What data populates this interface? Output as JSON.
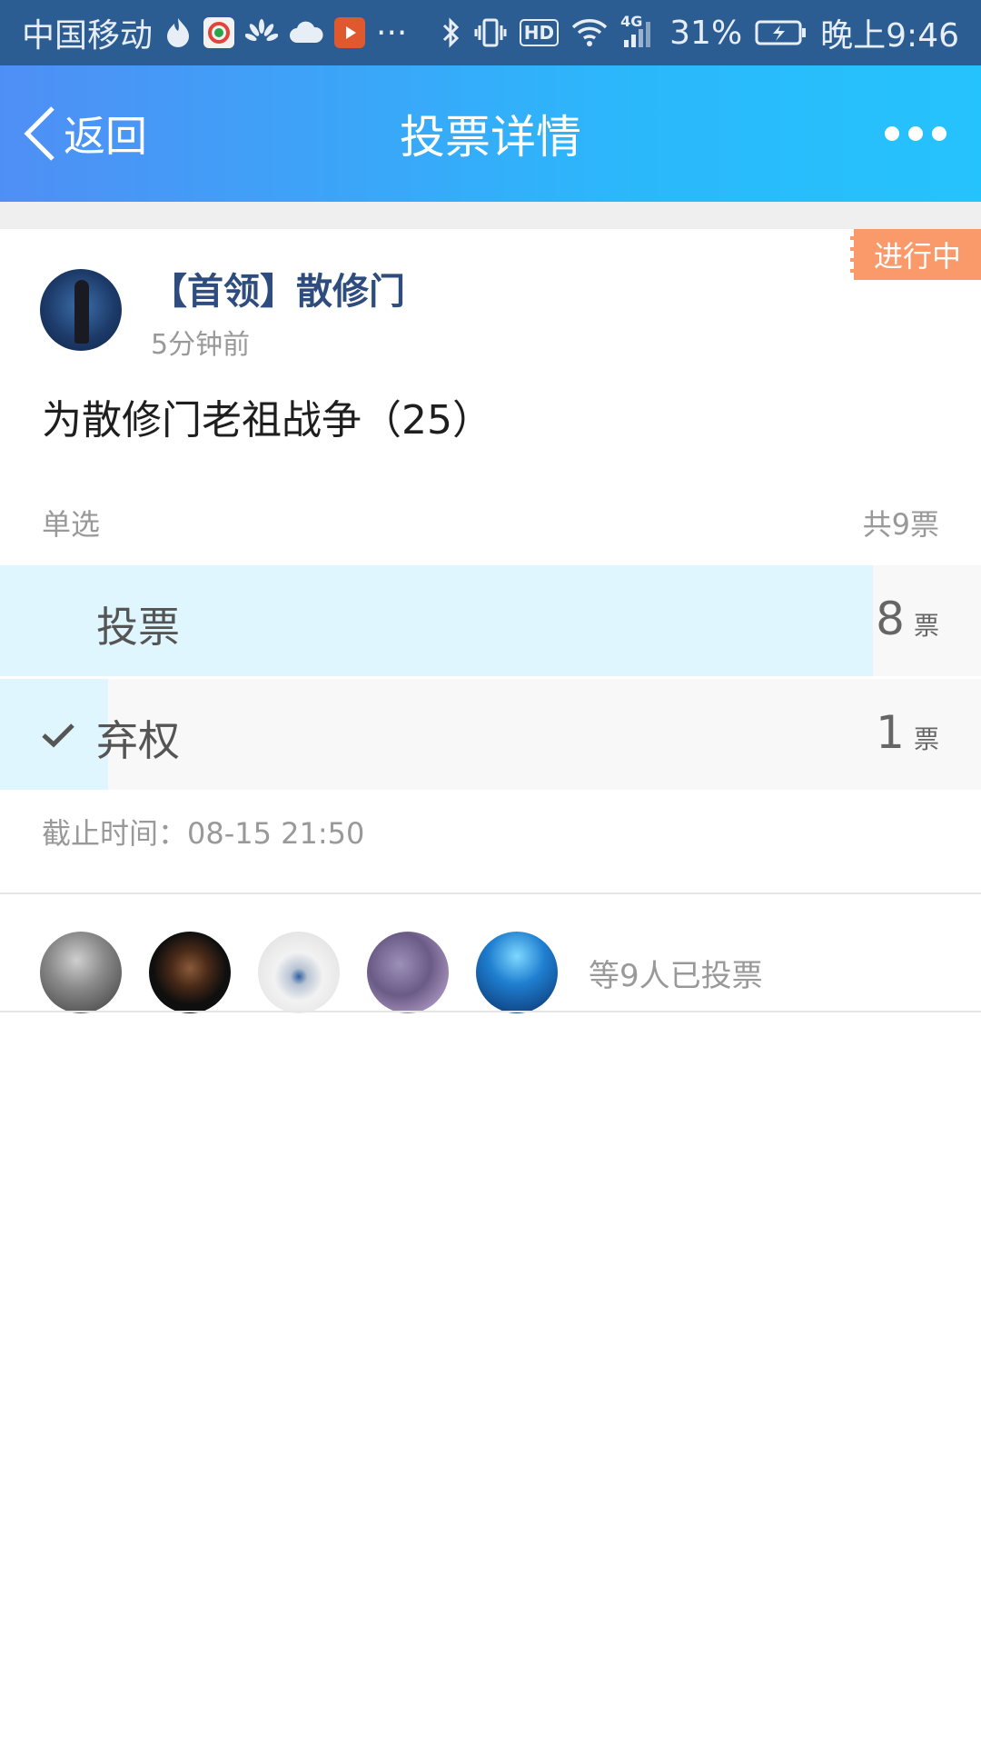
{
  "status_bar": {
    "carrier": "中国移动",
    "more": "···",
    "network": "4G",
    "hd": "HD",
    "battery": "31%",
    "time": "晚上9:46"
  },
  "nav": {
    "back_label": "返回",
    "title": "投票详情"
  },
  "post": {
    "status_tag": "进行中",
    "author": "【首领】散修门",
    "time": "5分钟前",
    "title": "为散修门老祖战争（25）"
  },
  "vote": {
    "mode": "单选",
    "total": "共9票",
    "options": [
      {
        "label": "投票",
        "count": "8",
        "unit": "票",
        "share": 0.89,
        "selected": false
      },
      {
        "label": "弃权",
        "count": "1",
        "unit": "票",
        "share": 0.11,
        "selected": true
      }
    ],
    "deadline": "截止时间：08-15 21:50"
  },
  "voters": {
    "summary": "等9人已投票"
  },
  "colors": {
    "nav_start": "#4f8ff5",
    "nav_end": "#25c3fd",
    "status_tag": "#fa9a6a",
    "author_name": "#2e4d7e",
    "option_fill": "#e0f6fe"
  }
}
